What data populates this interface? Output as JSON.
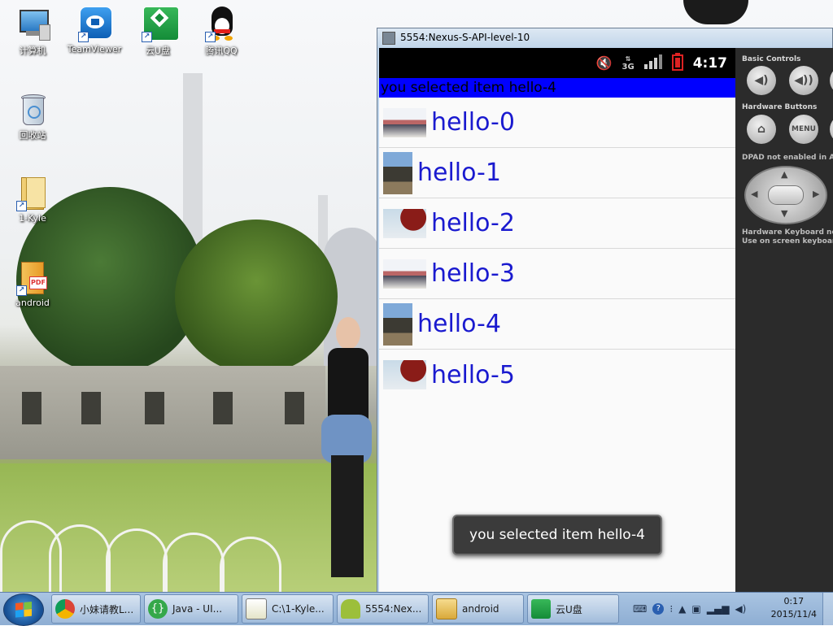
{
  "desktop": {
    "icons": [
      {
        "label": "计算机",
        "icon": "computer-icon"
      },
      {
        "label": "TeamViewer",
        "icon": "teamviewer-icon"
      },
      {
        "label": "云U盘",
        "icon": "cloud-drive-icon"
      },
      {
        "label": "腾讯QQ",
        "icon": "qq-penguin-icon"
      },
      {
        "label": "回收站",
        "icon": "recycle-bin-icon"
      },
      {
        "label": "1-Kyle",
        "icon": "folder-icon"
      },
      {
        "label": "android",
        "icon": "pdf-file-icon"
      }
    ]
  },
  "emulator": {
    "title": "5554:Nexus-S-API-level-10",
    "status_bar": {
      "time": "4:17",
      "network": "3G",
      "icons": [
        "mute-icon",
        "3g-icon",
        "signal-icon",
        "battery-alert-icon"
      ]
    },
    "selected_banner": "you selected item hello-4",
    "list_items": [
      {
        "label": "hello-0",
        "thumb": "photo-group-thumb"
      },
      {
        "label": "hello-1",
        "thumb": "photo-atv-thumb"
      },
      {
        "label": "hello-2",
        "thumb": "photo-balloon-thumb"
      },
      {
        "label": "hello-3",
        "thumb": "photo-group-thumb"
      },
      {
        "label": "hello-4",
        "thumb": "photo-atv-thumb"
      },
      {
        "label": "hello-5",
        "thumb": "photo-balloon-thumb"
      }
    ],
    "toast": "you selected item hello-4",
    "controls": {
      "basic_controls": "Basic Controls",
      "hardware_buttons": "Hardware Buttons",
      "menu_label": "MENU",
      "dpad_note": "DPAD not enabled in AVD",
      "keyboard_note_1": "Hardware Keyboard not enabled in AVD",
      "keyboard_note_2": "Use on screen keyboard"
    }
  },
  "taskbar": {
    "buttons": [
      {
        "label": "小妹请教L...",
        "icon": "chrome-icon"
      },
      {
        "label": "Java - UI...",
        "icon": "eclipse-icon"
      },
      {
        "label": "C:\\1-Kyle...",
        "icon": "notepad-icon"
      },
      {
        "label": "5554:Nex...",
        "icon": "android-icon"
      },
      {
        "label": "android",
        "icon": "folder-icon"
      },
      {
        "label": "云U盘",
        "icon": "cloud-drive-icon"
      }
    ],
    "clock": {
      "time": "0:17",
      "date": "2015/11/4"
    }
  },
  "colors": {
    "banner_blue": "#0000ff",
    "list_text": "#1a1acf",
    "taskbar": "#9db9dc"
  }
}
